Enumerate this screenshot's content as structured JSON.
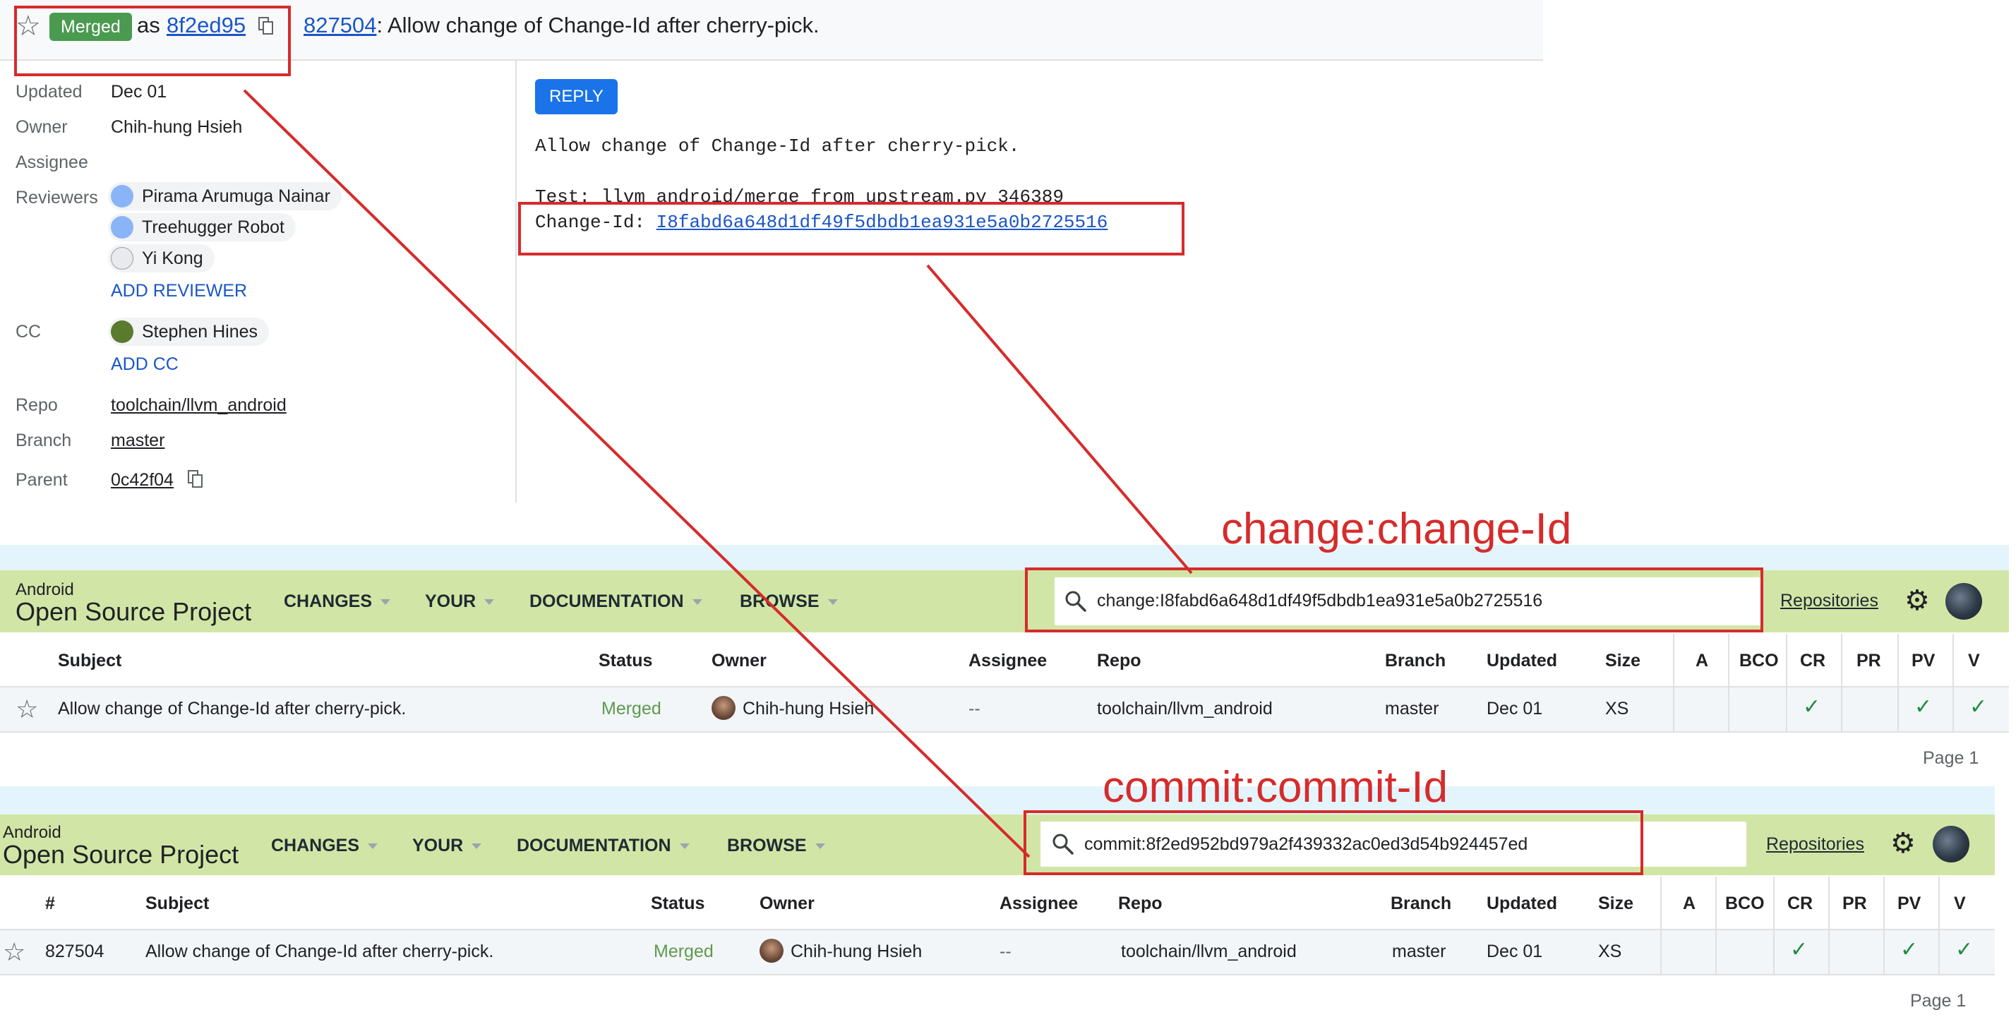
{
  "change_header": {
    "status_chip": "Merged",
    "as_label": "as",
    "commit_short": "8f2ed95",
    "change_number": "827504",
    "change_title_suffix": ": Allow change of Change-Id after cherry-pick."
  },
  "metadata": {
    "updated_label": "Updated",
    "updated_value": "Dec 01",
    "owner_label": "Owner",
    "owner_value": "Chih-hung Hsieh",
    "assignee_label": "Assignee",
    "reviewers_label": "Reviewers",
    "reviewers": [
      "Pirama Arumuga Nainar",
      "Treehugger Robot",
      "Yi Kong"
    ],
    "add_reviewer": "ADD REVIEWER",
    "cc_label": "CC",
    "cc": [
      "Stephen Hines"
    ],
    "add_cc": "ADD CC",
    "repo_label": "Repo",
    "repo_value": "toolchain/llvm_android",
    "branch_label": "Branch",
    "branch_value": "master",
    "parent_label": "Parent",
    "parent_value": "0c42f04"
  },
  "commit_message": {
    "reply_button": "REPLY",
    "subject": "Allow change of Change-Id after cherry-pick.",
    "test_line": "Test: llvm_android/merge_from_upstream.py 346389",
    "change_id_prefix": "Change-Id: ",
    "change_id": "I8fabd6a648d1df49f5dbdb1ea931e5a0b2725516"
  },
  "annotations": {
    "change_label": "change:change-Id",
    "commit_label": "commit:commit-Id"
  },
  "search_change": {
    "brand_small": "Android",
    "brand_big": "Open Source Project",
    "nav": [
      "CHANGES",
      "YOUR",
      "DOCUMENTATION",
      "BROWSE"
    ],
    "query": "change:I8fabd6a648d1df49f5dbdb1ea931e5a0b2725516",
    "repositories_link": "Repositories",
    "columns": [
      "Subject",
      "Status",
      "Owner",
      "Assignee",
      "Repo",
      "Branch",
      "Updated",
      "Size",
      "A",
      "BCO",
      "CR",
      "PR",
      "PV",
      "V"
    ],
    "row": {
      "subject": "Allow change of Change-Id after cherry-pick.",
      "status": "Merged",
      "owner": "Chih-hung Hsieh",
      "assignee": "--",
      "repo": "toolchain/llvm_android",
      "branch": "master",
      "updated": "Dec 01",
      "size": "XS",
      "check": "✓"
    },
    "page": "Page 1"
  },
  "search_commit": {
    "brand_small": "Android",
    "brand_big": "Open Source Project",
    "nav": [
      "CHANGES",
      "YOUR",
      "DOCUMENTATION",
      "BROWSE"
    ],
    "query": "commit:8f2ed952bd979a2f439332ac0ed3d54b924457ed",
    "repositories_link": "Repositories",
    "columns": [
      "#",
      "Subject",
      "Status",
      "Owner",
      "Assignee",
      "Repo",
      "Branch",
      "Updated",
      "Size",
      "A",
      "BCO",
      "CR",
      "PR",
      "PV",
      "V"
    ],
    "row": {
      "number": "827504",
      "subject": "Allow change of Change-Id after cherry-pick.",
      "status": "Merged",
      "owner": "Chih-hung Hsieh",
      "assignee": "--",
      "repo": "toolchain/llvm_android",
      "branch": "master",
      "updated": "Dec 01",
      "size": "XS",
      "check": "✓"
    },
    "page": "Page 1"
  },
  "colors": {
    "annotation_red": "#d62b2b",
    "merged_green": "#4a9a50",
    "header_green": "#d1e6a6",
    "link_blue": "#1a56c8",
    "reply_blue": "#1a73e8"
  }
}
